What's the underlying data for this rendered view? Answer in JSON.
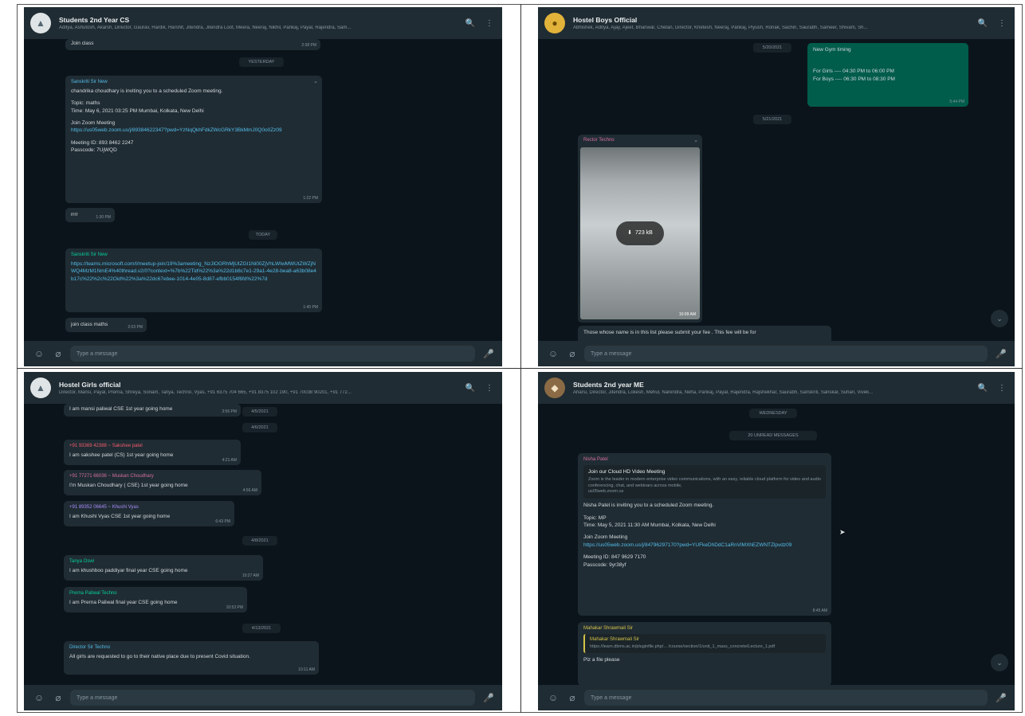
{
  "panels": {
    "p1": {
      "title": "Students 2nd Year CS",
      "members": "Aditya, Ashutosh, Akarsh, Director, Gaurav, Hardik, Harshit, Jitendra, Jitendra Loot, Meera, Neeraj, Nikhil, Pankaj, Payal, Rajendra, Sam...",
      "input_placeholder": "Type a message",
      "messages": {
        "m0_text": "Join class",
        "m0_time": "2:38 PM",
        "date1": "YESTERDAY",
        "m1_sender": "Sanskriti Sir New",
        "m1_l1": "chandrika choudhary is inviting you to a scheduled Zoom meeting.",
        "m1_l2": "Topic: maths",
        "m1_l3": "Time: May 6, 2021 03:25 PM Mumbai, Kolkata, New Delhi",
        "m1_l4": "Join Zoom Meeting",
        "m1_link": "https://us05web.zoom.us/j/89384622347?pwd=YzNqQkhFdkZWcGRkY3BkMmJ0Q0o0Zz09",
        "m1_l5": "Meeting ID: 893 8462 2247",
        "m1_l6": "Passcode: 7UjWQD",
        "m1_time": "1:22 PM",
        "m2_text": "rrrr",
        "m2_time": "1:30 PM",
        "date2": "TODAY",
        "m3_sender": "Sanskriti Sir New",
        "m3_link": "https://teams.microsoft.com/l/meetup-join/19%3ameeting_NzJlOGRhMjUtZGI1Ni00ZjVhLWIwMWUtZWZjNWQ4MzM1NmE4%40thread.v2/0?context=%7b%22Tid%22%3a%22d1b8c7e1-29a1-4e28-bea8-a63b08e4b17c%22%2c%22Oid%22%3a%22dc67ebee-1014-4e05-8d87-efbb0154f6fd%22%7d",
        "m3_time": "1:40 PM",
        "m4_text": "join class maths",
        "m4_time": "2:03 PM"
      }
    },
    "p2": {
      "title": "Hostel Boys Official",
      "members": "Abhishek, Aditya, Ajay, Ajeet, Bhanwar, Chetan, Director, Khetesh, Neeraj, Pankaj, Piyush, Ronak, Sachin, Saurabh, Sameer, Shivam, Sh...",
      "input_placeholder": "Type a message",
      "messages": {
        "date1": "5/20/2021",
        "m1_l1": "New Gym timing",
        "m1_l2": "For Girls ---- 04:30 PM to 06:00 PM",
        "m1_l3": "For Boys ---- 06:30 PM to 08:30 PM",
        "m1_time": "5:44 PM",
        "date2": "5/21/2021",
        "m2_sender": "Rector Techno",
        "m2_download": "723 kB",
        "m2_media_time": "10:09 AM",
        "m3_text": "Those whose name is in this list please submit your fee . This fee will be for"
      }
    },
    "p3": {
      "title": "Hostel Girls official",
      "members": "Director, Mansi, Payal, Prerna, Shreya, Sonam, Tanya, Techno, Vyas, +91 6375 704 665, +91 8375 102 190, +91 70038 90201, +91 772...",
      "input_placeholder": "Type a message",
      "messages": {
        "m0_text": "I am mansi paliwal CSE 1st year going home",
        "m0_time": "3:56 PM",
        "date1": "4/5/2021",
        "date2": "4/6/2021",
        "m1_sender": "+91 93369 42388 ~ Sakshee patel",
        "m1_text": "I am sakshee patel (CS) 1st year going home",
        "m1_time": "4:21 AM",
        "m2_sender": "+91 77271 66036 ~ Muskan Choudhary",
        "m2_text": "I'm Muskan Choudhary ( CSE) 1st year going home",
        "m2_time": "4:56 AM",
        "m3_sender": "+91 89352 06645 ~ Khushi Vyas",
        "m3_text": "I am Khushi Vyas CSE 1st year going home",
        "m3_time": "6:43 PM",
        "date3": "4/8/2021",
        "m4_sender": "Tanya Oswi",
        "m4_text": "I am khushboo paddiyar final year CSE going home",
        "m4_time": "10:27 AM",
        "m5_sender": "Prerna Paliwal Techno",
        "m5_text": "I am Prerna Paliwal final year CSE going home",
        "m5_time": "10:53 PM",
        "date4": "4/13/2021",
        "m6_sender": "Director Sir Techno",
        "m6_text": "All girls are requested to go to their native place due to present Covid situation.",
        "m6_time": "10:11 AM"
      }
    },
    "p4": {
      "title": "Students 2nd year ME",
      "members": "Aharsi, Director, Jitendra, Lokesh, Mehul, Narendra, Neha, Pankaj, Payal, Rajendra, Rajshekhar, Saurabh, Sanskriti, Sanskar, Suhan, Vivek...",
      "input_placeholder": "Type a message",
      "messages": {
        "date1": "WEDNESDAY",
        "unread": "20 UNREAD MESSAGES",
        "m1_sender": "Nisha Patel",
        "m1_pv_title": "Join our Cloud HD Video Meeting",
        "m1_pv_desc": "Zoom is the leader in modern enterprise video communications, with an easy, reliable cloud platform for video and audio conferencing, chat, and webinars across mobile,",
        "m1_pv_domain": "us05web.zoom.us",
        "m1_l1": "Nisha Patel is inviting you to a scheduled Zoom meeting.",
        "m1_l2": "Topic: MP",
        "m1_l3": "Time: May 5, 2021 11:30 AM Mumbai, Kolkata, New Delhi",
        "m1_l4": "Join Zoom Meeting",
        "m1_link": "https://us05web.zoom.us/j/84796297170?pwd=YUFkeDhDdC1aRnVlMXhEZWNTZlpvdz09",
        "m1_l5": "Meeting ID: 847 9629 7170",
        "m1_l6": "Passcode: 9yr38yf",
        "m1_time": "8:45 AM",
        "m2_sender": "Mahakar Shrawmali Sir",
        "m2_q_name": "Mahakar Shrawmali Sir",
        "m2_q_text": "https://learn.dbms.ac.in/pluginfile.php/... /course/section/1/unit_1_mass_concrete/Lecture_1.pdf",
        "m2_text": "Plz a file please"
      }
    }
  },
  "icons": {
    "search": "🔍",
    "menu": "⋮",
    "emoji": "☺",
    "attach": "⌀",
    "mic": "🎤",
    "down": "⌄",
    "download": "⬇",
    "cursor": "➤"
  }
}
